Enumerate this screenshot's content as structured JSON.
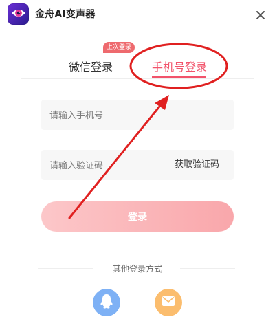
{
  "app": {
    "title": "金舟AI变声器",
    "logo_icon": "eye-logo-icon",
    "close_icon": "close-icon"
  },
  "tabs": [
    {
      "label": "微信登录",
      "active": false
    },
    {
      "label": "手机号登录",
      "active": true
    }
  ],
  "last_login_badge": "上次登录",
  "form": {
    "phone_placeholder": "请输入手机号",
    "code_placeholder": "请输入验证码",
    "get_code_label": "获取验证码",
    "login_label": "登录"
  },
  "other_login": {
    "label": "其他登录方式",
    "options": [
      {
        "icon": "qq-penguin-icon",
        "color": "#7eb1f5"
      },
      {
        "icon": "mail-icon",
        "color": "#fbbd6e"
      }
    ]
  },
  "colors": {
    "accent": "#f2536b",
    "annotation": "#e02020",
    "login_gradient_start": "#fcc7c9",
    "login_gradient_end": "#f9a7ab"
  }
}
